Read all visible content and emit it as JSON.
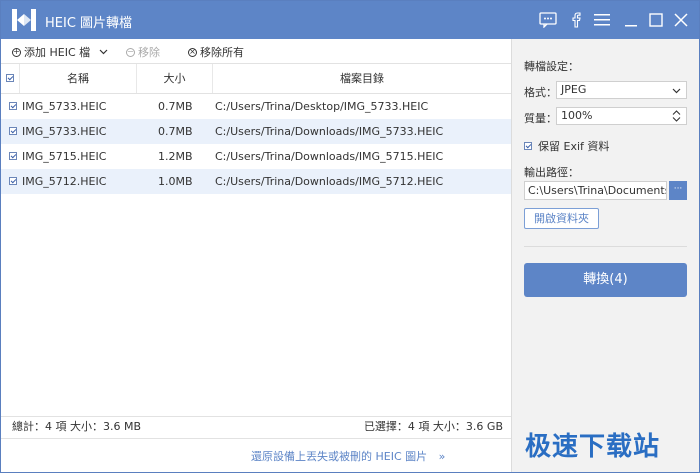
{
  "app": {
    "title": "HEIC 圖片轉檔"
  },
  "toolbar": {
    "add_label": "添加 HEIC 檔",
    "remove_label": "移除",
    "remove_all_label": "移除所有"
  },
  "table": {
    "columns": [
      "名稱",
      "大小",
      "檔案目錄"
    ],
    "rows": [
      {
        "name": "IMG_5733.HEIC",
        "size": "0.7MB",
        "path": "C:/Users/Trina/Desktop/IMG_5733.HEIC"
      },
      {
        "name": "IMG_5733.HEIC",
        "size": "0.7MB",
        "path": "C:/Users/Trina/Downloads/IMG_5733.HEIC"
      },
      {
        "name": "IMG_5715.HEIC",
        "size": "1.2MB",
        "path": "C:/Users/Trina/Downloads/IMG_5715.HEIC"
      },
      {
        "name": "IMG_5712.HEIC",
        "size": "1.0MB",
        "path": "C:/Users/Trina/Downloads/IMG_5712.HEIC"
      }
    ]
  },
  "status": {
    "total": "總計：4 項 大小：3.6 MB",
    "selected": "已選擇：4 項 大小：3.6 GB"
  },
  "footer": {
    "recover_link": "還原設備上丟失或被刪的 HEIC 圖片"
  },
  "settings": {
    "heading": "轉檔設定：",
    "format_label": "格式：",
    "format_value": "JPEG",
    "quality_label": "質量：",
    "quality_value": "100%",
    "keep_exif_label": "保留 Exif 資料",
    "output_label": "輸出路徑：",
    "output_path": "C:\\Users\\Trina\\Documents\\",
    "browse_label": "···",
    "open_folder_label": "開啟資料夾",
    "convert_label": "轉換(4)"
  },
  "watermark": "极速下载站",
  "colors": {
    "accent": "#5d85c7",
    "row_alt": "#eaf1fb",
    "panel": "#f2f2f2"
  }
}
